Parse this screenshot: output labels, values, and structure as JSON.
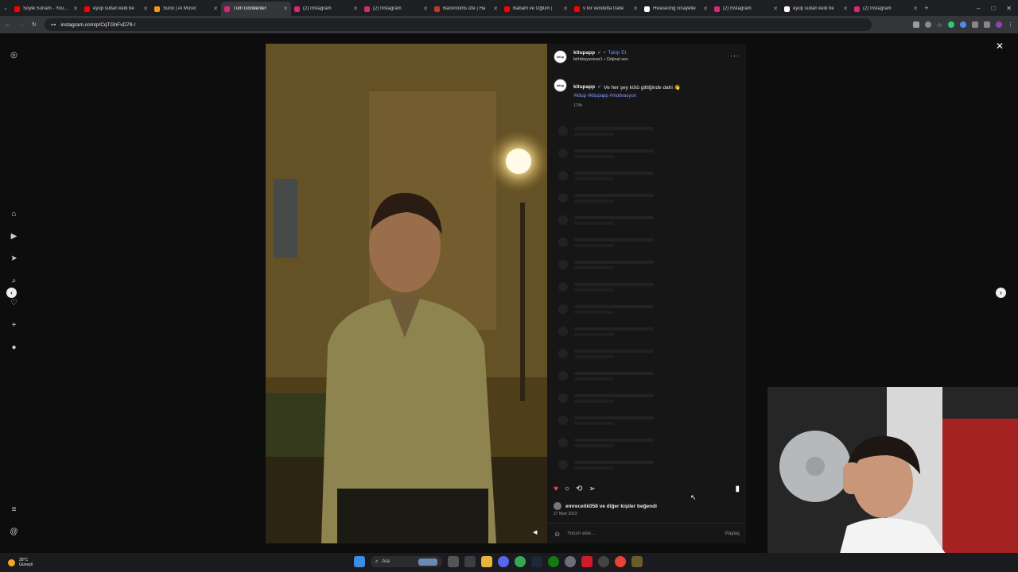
{
  "browser": {
    "tabs": [
      {
        "title": "Söyle Sunam - YouTube",
        "color": "#ff0000"
      },
      {
        "title": "eyüp sultan kedi be",
        "color": "#ff0000"
      },
      {
        "title": "Suno | AI Music",
        "color": "#f39c12"
      },
      {
        "title": "Tüm Gönderiler",
        "color": "#d62976",
        "active": true
      },
      {
        "title": "(2) Instagram",
        "color": "#d62976"
      },
      {
        "title": "(2) Instagram",
        "color": "#d62976"
      },
      {
        "title": "Backrooms izle | Ha",
        "color": "#c0392b"
      },
      {
        "title": "Babam ve Oğlum | ",
        "color": "#ff0000"
      },
      {
        "title": "v for vendetta traile",
        "color": "#ff0000"
      },
      {
        "title": "Hwaseong cinayetle",
        "color": "#ffffff"
      },
      {
        "title": "(2) Instagram",
        "color": "#d62976"
      },
      {
        "title": "eyüp sultan kedi be",
        "color": "#ffffff"
      },
      {
        "title": "(2) Instagram",
        "color": "#d62976"
      }
    ],
    "url": "instagram.com/p/CqTGhFvD79-/",
    "new_tab": "+"
  },
  "post": {
    "username": "kitupapp",
    "follow_label": "Takip Et",
    "audio": "birhikayesivar1 • Orijinal ses",
    "avatar_text": "kitüp",
    "more": "···",
    "caption": "Ve her şey kötü gittiğinde dahi 👋",
    "hashtags": "#kitup #kitupapp #motivasyon",
    "caption_age": "174h",
    "likes": "emrecelik058 ve diğer kişiler beğendi",
    "date": "27 Mart 2023",
    "comment_placeholder": "Yorum ekle...",
    "share_label": "Paylaş"
  },
  "taskbar": {
    "temp": "28°C",
    "weather": "Güneşli",
    "search": "Ara"
  }
}
